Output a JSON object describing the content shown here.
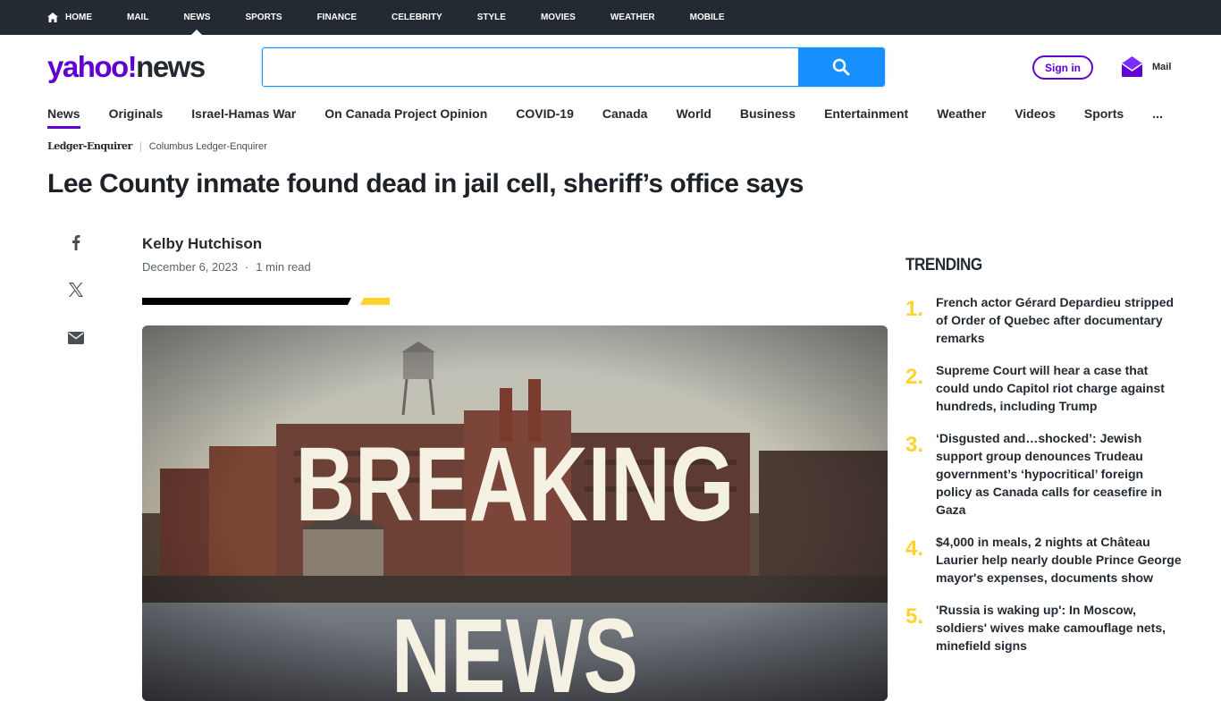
{
  "topnav": [
    "HOME",
    "MAIL",
    "NEWS",
    "SPORTS",
    "FINANCE",
    "CELEBRITY",
    "STYLE",
    "MOVIES",
    "WEATHER",
    "MOBILE"
  ],
  "logo": {
    "brand": "yahoo!",
    "section": "news"
  },
  "search": {
    "value": "",
    "placeholder": ""
  },
  "header": {
    "signin": "Sign in",
    "mail": "Mail"
  },
  "subnav": [
    "News",
    "Originals",
    "Israel-Hamas War",
    "On Canada Project Opinion",
    "COVID-19",
    "Canada",
    "World",
    "Business",
    "Entertainment",
    "Weather",
    "Videos",
    "Sports",
    "..."
  ],
  "article": {
    "source_brand": "Ledger-Enquirer",
    "source_name": "Columbus Ledger-Enquirer",
    "headline": "Lee County inmate found dead in jail cell, sheriff’s office says",
    "author": "Kelby Hutchison",
    "date": "December 6, 2023",
    "read_time": "1 min read",
    "hero_text_1": "BREAKING",
    "hero_text_2": "NEWS"
  },
  "trending": {
    "title": "TRENDING",
    "items": [
      {
        "num": "1.",
        "text": "French actor Gérard Depardieu stripped of Order of Quebec after documentary remarks"
      },
      {
        "num": "2.",
        "text": "Supreme Court will hear a case that could undo Capitol riot charge against hundreds, including Trump"
      },
      {
        "num": "3.",
        "text": "‘Disgusted and…shocked’: Jewish support group denounces Trudeau government’s ‘hypocritical’ foreign policy as Canada calls for ceasefire in Gaza"
      },
      {
        "num": "4.",
        "text": "$4,000 in meals, 2 nights at Château Laurier help nearly double Prince George mayor's expenses, documents show"
      },
      {
        "num": "5.",
        "text": "'Russia is waking up': In Moscow, soldiers' wives make camouflage nets, minefield signs"
      }
    ]
  },
  "colors": {
    "brand_purple": "#6001d2",
    "search_blue": "#188fff",
    "trending_yellow": "#ffd22e",
    "topbar": "#232a31"
  }
}
